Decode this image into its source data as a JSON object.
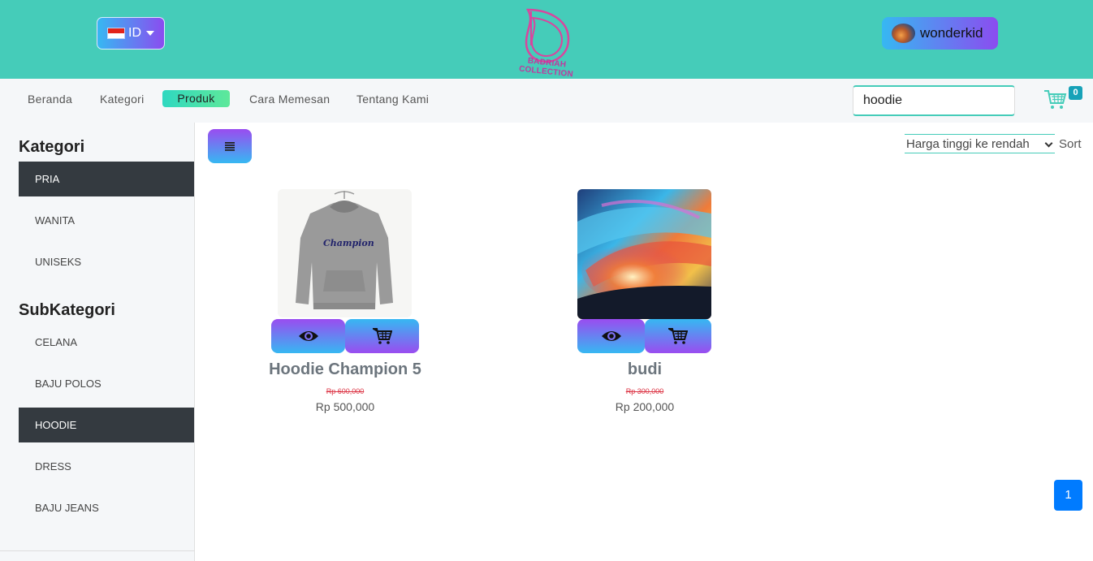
{
  "header": {
    "language_label": "ID",
    "logo_text": "BADRIAH COLLECTION",
    "username": "wonderkid"
  },
  "nav": {
    "items": [
      {
        "label": "Beranda",
        "active": false
      },
      {
        "label": "Kategori",
        "active": false
      },
      {
        "label": "Produk",
        "active": true
      },
      {
        "label": "Cara Memesan",
        "active": false
      },
      {
        "label": "Tentang Kami",
        "active": false
      }
    ],
    "search_value": "hoodie",
    "cart_count": "0"
  },
  "sidebar": {
    "kategori_title": "Kategori",
    "kategori": [
      {
        "label": "PRIA",
        "active": true
      },
      {
        "label": "WANITA",
        "active": false
      },
      {
        "label": "UNISEKS",
        "active": false
      }
    ],
    "subkategori_title": "SubKategori",
    "subkategori": [
      {
        "label": "CELANA",
        "active": false
      },
      {
        "label": "BAJU POLOS",
        "active": false
      },
      {
        "label": "HOODIE",
        "active": true
      },
      {
        "label": "DRESS",
        "active": false
      },
      {
        "label": "BAJU JEANS",
        "active": false
      }
    ]
  },
  "toolbar": {
    "sort_selected": "Harga tinggi ke rendah",
    "sort_label": "Sort"
  },
  "products": [
    {
      "name": "Hoodie Champion 5",
      "old_price": "Rp 600,000",
      "price": "Rp 500,000",
      "image_text": "Champion"
    },
    {
      "name": "budi",
      "old_price": "Rp 300,000",
      "price": "Rp 200,000"
    }
  ],
  "pagination": {
    "current": "1"
  },
  "colors": {
    "header_bg": "#45ccb9",
    "accent_gradient_start": "#36b8f2",
    "accent_gradient_end": "#8b4cf0",
    "sidebar_active": "#343a40",
    "page_button": "#007bff",
    "cart_badge": "#17a2b8"
  }
}
